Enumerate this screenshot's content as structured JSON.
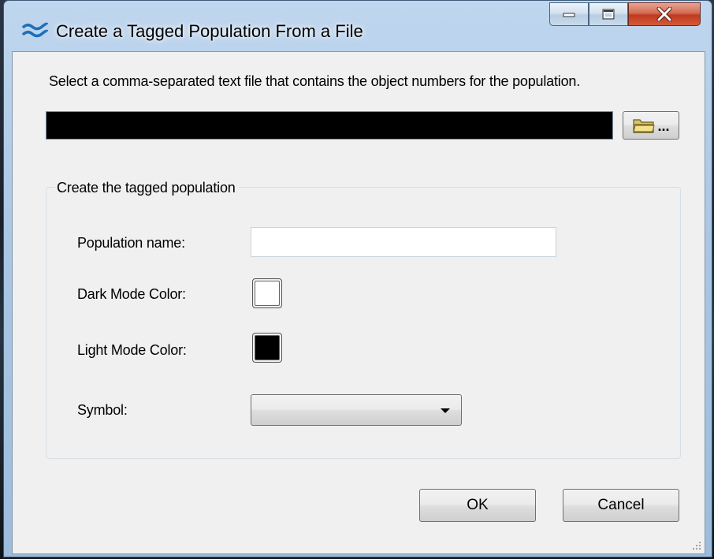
{
  "window": {
    "title": "Create a Tagged Population From a File",
    "icon": "wave-icon"
  },
  "caption_buttons": {
    "minimize_icon": "minimize-icon",
    "maximize_icon": "maximize-icon",
    "close_icon": "close-icon"
  },
  "file_selection": {
    "instruction": "Select a comma-separated text file that contains the object numbers for the population.",
    "path_value": "",
    "browse_icon": "folder-icon",
    "browse_label": "..."
  },
  "group": {
    "title": "Create the tagged population",
    "population_name_label": "Population name:",
    "population_name_value": "",
    "dark_mode_label": "Dark Mode Color:",
    "dark_mode_color": "#ffffff",
    "light_mode_label": "Light Mode Color:",
    "light_mode_color": "#000000",
    "symbol_label": "Symbol:",
    "symbol_value": ""
  },
  "buttons": {
    "ok": "OK",
    "cancel": "Cancel"
  }
}
